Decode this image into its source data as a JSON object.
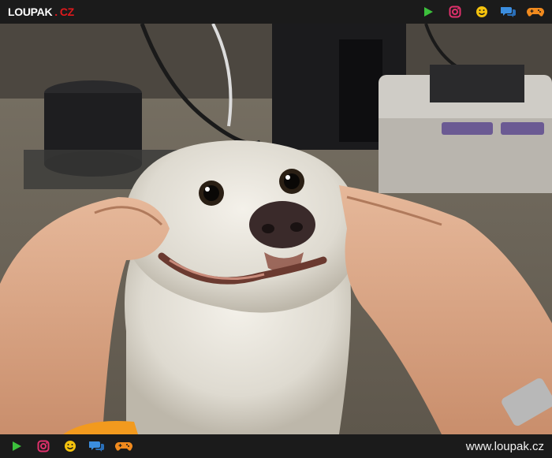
{
  "header": {
    "logo_main": "LOUPAK",
    "logo_dot": ".",
    "logo_tld": "CZ",
    "icons": [
      "play-icon",
      "instagram-icon",
      "smiley-icon",
      "chat-icon",
      "gamepad-icon"
    ]
  },
  "footer": {
    "icons": [
      "play-icon",
      "instagram-icon",
      "smiley-icon",
      "chat-icon",
      "gamepad-icon"
    ],
    "url": "www.loupak.cz"
  },
  "colors": {
    "bar_bg": "#1b1b1b",
    "play": "#3cc03c",
    "instagram": "#e1306c",
    "smiley": "#f4c20d",
    "chat": "#3b8ee0",
    "gamepad": "#f08a1e",
    "logo_red": "#e0191c"
  }
}
